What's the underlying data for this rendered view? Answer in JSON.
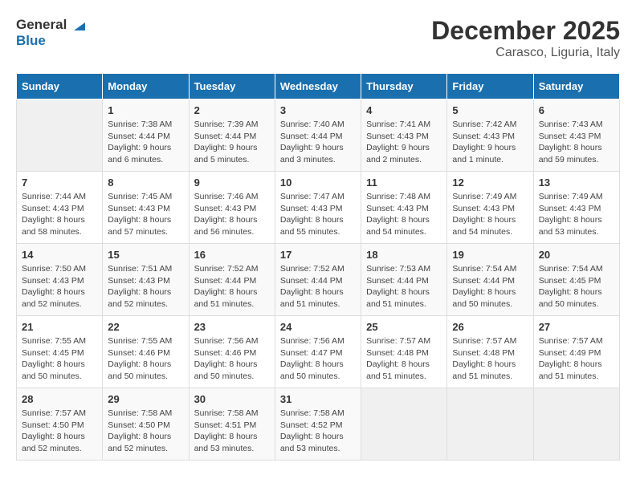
{
  "header": {
    "logo_general": "General",
    "logo_blue": "Blue",
    "month_title": "December 2025",
    "location": "Carasco, Liguria, Italy"
  },
  "days_of_week": [
    "Sunday",
    "Monday",
    "Tuesday",
    "Wednesday",
    "Thursday",
    "Friday",
    "Saturday"
  ],
  "weeks": [
    [
      {
        "day": "",
        "info": ""
      },
      {
        "day": "1",
        "info": "Sunrise: 7:38 AM\nSunset: 4:44 PM\nDaylight: 9 hours\nand 6 minutes."
      },
      {
        "day": "2",
        "info": "Sunrise: 7:39 AM\nSunset: 4:44 PM\nDaylight: 9 hours\nand 5 minutes."
      },
      {
        "day": "3",
        "info": "Sunrise: 7:40 AM\nSunset: 4:44 PM\nDaylight: 9 hours\nand 3 minutes."
      },
      {
        "day": "4",
        "info": "Sunrise: 7:41 AM\nSunset: 4:43 PM\nDaylight: 9 hours\nand 2 minutes."
      },
      {
        "day": "5",
        "info": "Sunrise: 7:42 AM\nSunset: 4:43 PM\nDaylight: 9 hours\nand 1 minute."
      },
      {
        "day": "6",
        "info": "Sunrise: 7:43 AM\nSunset: 4:43 PM\nDaylight: 8 hours\nand 59 minutes."
      }
    ],
    [
      {
        "day": "7",
        "info": "Sunrise: 7:44 AM\nSunset: 4:43 PM\nDaylight: 8 hours\nand 58 minutes."
      },
      {
        "day": "8",
        "info": "Sunrise: 7:45 AM\nSunset: 4:43 PM\nDaylight: 8 hours\nand 57 minutes."
      },
      {
        "day": "9",
        "info": "Sunrise: 7:46 AM\nSunset: 4:43 PM\nDaylight: 8 hours\nand 56 minutes."
      },
      {
        "day": "10",
        "info": "Sunrise: 7:47 AM\nSunset: 4:43 PM\nDaylight: 8 hours\nand 55 minutes."
      },
      {
        "day": "11",
        "info": "Sunrise: 7:48 AM\nSunset: 4:43 PM\nDaylight: 8 hours\nand 54 minutes."
      },
      {
        "day": "12",
        "info": "Sunrise: 7:49 AM\nSunset: 4:43 PM\nDaylight: 8 hours\nand 54 minutes."
      },
      {
        "day": "13",
        "info": "Sunrise: 7:49 AM\nSunset: 4:43 PM\nDaylight: 8 hours\nand 53 minutes."
      }
    ],
    [
      {
        "day": "14",
        "info": "Sunrise: 7:50 AM\nSunset: 4:43 PM\nDaylight: 8 hours\nand 52 minutes."
      },
      {
        "day": "15",
        "info": "Sunrise: 7:51 AM\nSunset: 4:43 PM\nDaylight: 8 hours\nand 52 minutes."
      },
      {
        "day": "16",
        "info": "Sunrise: 7:52 AM\nSunset: 4:44 PM\nDaylight: 8 hours\nand 51 minutes."
      },
      {
        "day": "17",
        "info": "Sunrise: 7:52 AM\nSunset: 4:44 PM\nDaylight: 8 hours\nand 51 minutes."
      },
      {
        "day": "18",
        "info": "Sunrise: 7:53 AM\nSunset: 4:44 PM\nDaylight: 8 hours\nand 51 minutes."
      },
      {
        "day": "19",
        "info": "Sunrise: 7:54 AM\nSunset: 4:44 PM\nDaylight: 8 hours\nand 50 minutes."
      },
      {
        "day": "20",
        "info": "Sunrise: 7:54 AM\nSunset: 4:45 PM\nDaylight: 8 hours\nand 50 minutes."
      }
    ],
    [
      {
        "day": "21",
        "info": "Sunrise: 7:55 AM\nSunset: 4:45 PM\nDaylight: 8 hours\nand 50 minutes."
      },
      {
        "day": "22",
        "info": "Sunrise: 7:55 AM\nSunset: 4:46 PM\nDaylight: 8 hours\nand 50 minutes."
      },
      {
        "day": "23",
        "info": "Sunrise: 7:56 AM\nSunset: 4:46 PM\nDaylight: 8 hours\nand 50 minutes."
      },
      {
        "day": "24",
        "info": "Sunrise: 7:56 AM\nSunset: 4:47 PM\nDaylight: 8 hours\nand 50 minutes."
      },
      {
        "day": "25",
        "info": "Sunrise: 7:57 AM\nSunset: 4:48 PM\nDaylight: 8 hours\nand 51 minutes."
      },
      {
        "day": "26",
        "info": "Sunrise: 7:57 AM\nSunset: 4:48 PM\nDaylight: 8 hours\nand 51 minutes."
      },
      {
        "day": "27",
        "info": "Sunrise: 7:57 AM\nSunset: 4:49 PM\nDaylight: 8 hours\nand 51 minutes."
      }
    ],
    [
      {
        "day": "28",
        "info": "Sunrise: 7:57 AM\nSunset: 4:50 PM\nDaylight: 8 hours\nand 52 minutes."
      },
      {
        "day": "29",
        "info": "Sunrise: 7:58 AM\nSunset: 4:50 PM\nDaylight: 8 hours\nand 52 minutes."
      },
      {
        "day": "30",
        "info": "Sunrise: 7:58 AM\nSunset: 4:51 PM\nDaylight: 8 hours\nand 53 minutes."
      },
      {
        "day": "31",
        "info": "Sunrise: 7:58 AM\nSunset: 4:52 PM\nDaylight: 8 hours\nand 53 minutes."
      },
      {
        "day": "",
        "info": ""
      },
      {
        "day": "",
        "info": ""
      },
      {
        "day": "",
        "info": ""
      }
    ]
  ]
}
